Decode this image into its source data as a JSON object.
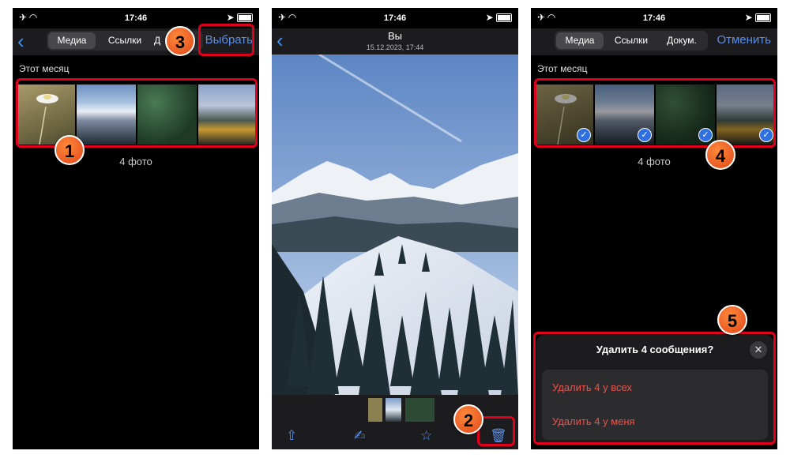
{
  "status": {
    "time": "17:46"
  },
  "panel1": {
    "tabs": [
      "Медиа",
      "Ссылки",
      "Д"
    ],
    "action": "Выбрать",
    "section": "Этот месяц",
    "count": "4 фото"
  },
  "panel2": {
    "title": "Вы",
    "subtitle": "15.12.2023, 17:44"
  },
  "panel3": {
    "tabs": [
      "Медиа",
      "Ссылки",
      "Докум."
    ],
    "action": "Отменить",
    "section": "Этот месяц",
    "count": "4 фото",
    "sheet_title": "Удалить 4 сообщения?",
    "option_all": "Удалить 4 у всех",
    "option_me": "Удалить 4 у меня"
  },
  "badges": [
    "1",
    "2",
    "3",
    "4",
    "5"
  ],
  "colors": {
    "accent": "#5b8fe8",
    "highlight": "#e0001b",
    "badge": "#f26a2a",
    "danger": "#e8554e"
  },
  "icons": [
    "back-icon",
    "share-icon",
    "draw-icon",
    "star-icon",
    "trash-icon",
    "close-icon",
    "check-icon",
    "wifi-icon",
    "airplane-icon",
    "location-icon",
    "battery-icon"
  ]
}
